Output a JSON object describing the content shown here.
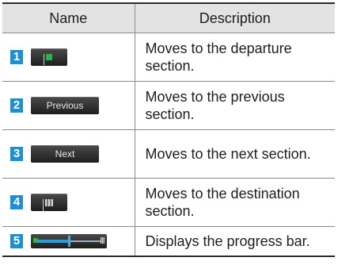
{
  "header": {
    "name": "Name",
    "description": "Description"
  },
  "rows": [
    {
      "number": "1",
      "control": {
        "type": "icon",
        "icon": "departure-flag-icon"
      },
      "description": "Moves to the departure section."
    },
    {
      "number": "2",
      "control": {
        "type": "button",
        "label": "Previous"
      },
      "description": "Moves to the previous section."
    },
    {
      "number": "3",
      "control": {
        "type": "button",
        "label": "Next"
      },
      "description": "Moves to the next section."
    },
    {
      "number": "4",
      "control": {
        "type": "icon",
        "icon": "destination-flag-icon"
      },
      "description": "Moves to the destination section."
    },
    {
      "number": "5",
      "control": {
        "type": "progress-bar",
        "progress": 0.5
      },
      "description": "Displays the progress bar."
    }
  ],
  "colors": {
    "number_badge": "#1d8fd3",
    "header_bg": "#e3e3e3",
    "button_bg": "#2e2e2e",
    "flag_green": "#2bb34a"
  }
}
